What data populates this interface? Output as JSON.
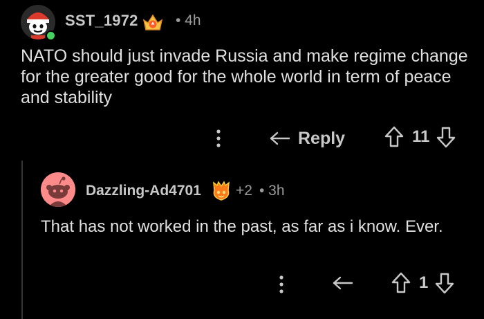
{
  "comment": {
    "username": "SST_1972",
    "time": "• 4h",
    "body": "NATO should just invade Russia and make regime change for the greater good for the whole world in term of peace and stability",
    "reply_label": "Reply",
    "vote_count": "11",
    "icons": [
      "snoo-avatar",
      "award-badge-icon",
      "more-options-icon",
      "reply-arrow-icon",
      "upvote-icon",
      "downvote-icon"
    ]
  },
  "reply": {
    "username": "Dazzling-Ad4701",
    "award_count": "+2",
    "time": "• 3h",
    "body": "That has not worked in the past, as far as i know. Ever.",
    "vote_count": "1",
    "icons": [
      "default-snoo-avatar",
      "award-badge-icon",
      "more-options-icon",
      "reply-arrow-icon",
      "upvote-icon",
      "downvote-icon"
    ]
  },
  "colors": {
    "background": "#000000",
    "text": "#e0e0e0",
    "muted": "#9b9b9b",
    "online": "#46d160",
    "avatar_pink": "#ff8a8a",
    "thread_line": "#343536"
  }
}
